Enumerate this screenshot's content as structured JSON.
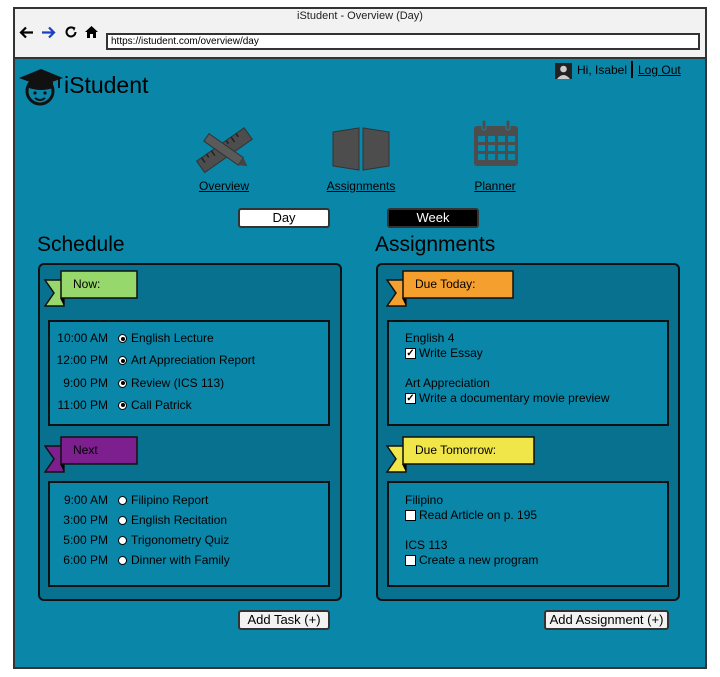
{
  "browser": {
    "title": "iStudent - Overview (Day)",
    "url": "https://istudent.com/overview/day",
    "back_icon": "arrow-left-icon",
    "forward_icon": "arrow-right-icon",
    "reload_icon": "reload-icon",
    "home_icon": "home-icon"
  },
  "app": {
    "name": "iStudent",
    "logo_icon": "graduate-cap-icon"
  },
  "user": {
    "greeting": "Hi, Isabel",
    "logout": "Log Out",
    "avatar_icon": "user-avatar-icon"
  },
  "nav": [
    {
      "label": "Overview",
      "icon": "ruler-pencil-icon"
    },
    {
      "label": "Assignments",
      "icon": "open-book-icon"
    },
    {
      "label": "Planner",
      "icon": "calendar-icon"
    }
  ],
  "view_toggle": {
    "day": "Day",
    "week": "Week"
  },
  "schedule": {
    "title": "Schedule",
    "now_label": "Now:",
    "now": [
      {
        "time": "10:00 AM",
        "task": "English Lecture",
        "selected": true
      },
      {
        "time": "12:00 PM",
        "task": "Art Appreciation Report",
        "selected": true
      },
      {
        "time": "9:00 PM",
        "task": "Review (ICS 113)",
        "selected": true
      },
      {
        "time": "11:00 PM",
        "task": "Call Patrick",
        "selected": true
      }
    ],
    "next_label": "Next",
    "next": [
      {
        "time": "9:00 AM",
        "task": "Filipino Report",
        "selected": false
      },
      {
        "time": "3:00 PM",
        "task": "English Recitation",
        "selected": false
      },
      {
        "time": "5:00 PM",
        "task": "Trigonometry Quiz",
        "selected": false
      },
      {
        "time": "6:00 PM",
        "task": "Dinner with Family",
        "selected": false
      }
    ],
    "add_button": "Add Task (+)"
  },
  "assignments": {
    "title": "Assignments",
    "today_label": "Due Today:",
    "today": [
      {
        "course": "English 4",
        "task": "Write Essay",
        "done": true
      },
      {
        "course": "Art Appreciation",
        "task": "Write a documentary movie preview",
        "done": true
      }
    ],
    "tomorrow_label": "Due Tomorrow:",
    "tomorrow": [
      {
        "course": "Filipino",
        "task": "Read Article on p. 195",
        "done": false
      },
      {
        "course": "ICS 113",
        "task": "Create a new program",
        "done": false
      }
    ],
    "add_button": "Add Assignment (+)"
  },
  "colors": {
    "background": "#0a86a8",
    "panel": "#08718f",
    "now_flag": "#97d86d",
    "next_flag": "#7d1f8f",
    "today_flag": "#f5a02e",
    "tomorrow_flag": "#f0e64a"
  }
}
